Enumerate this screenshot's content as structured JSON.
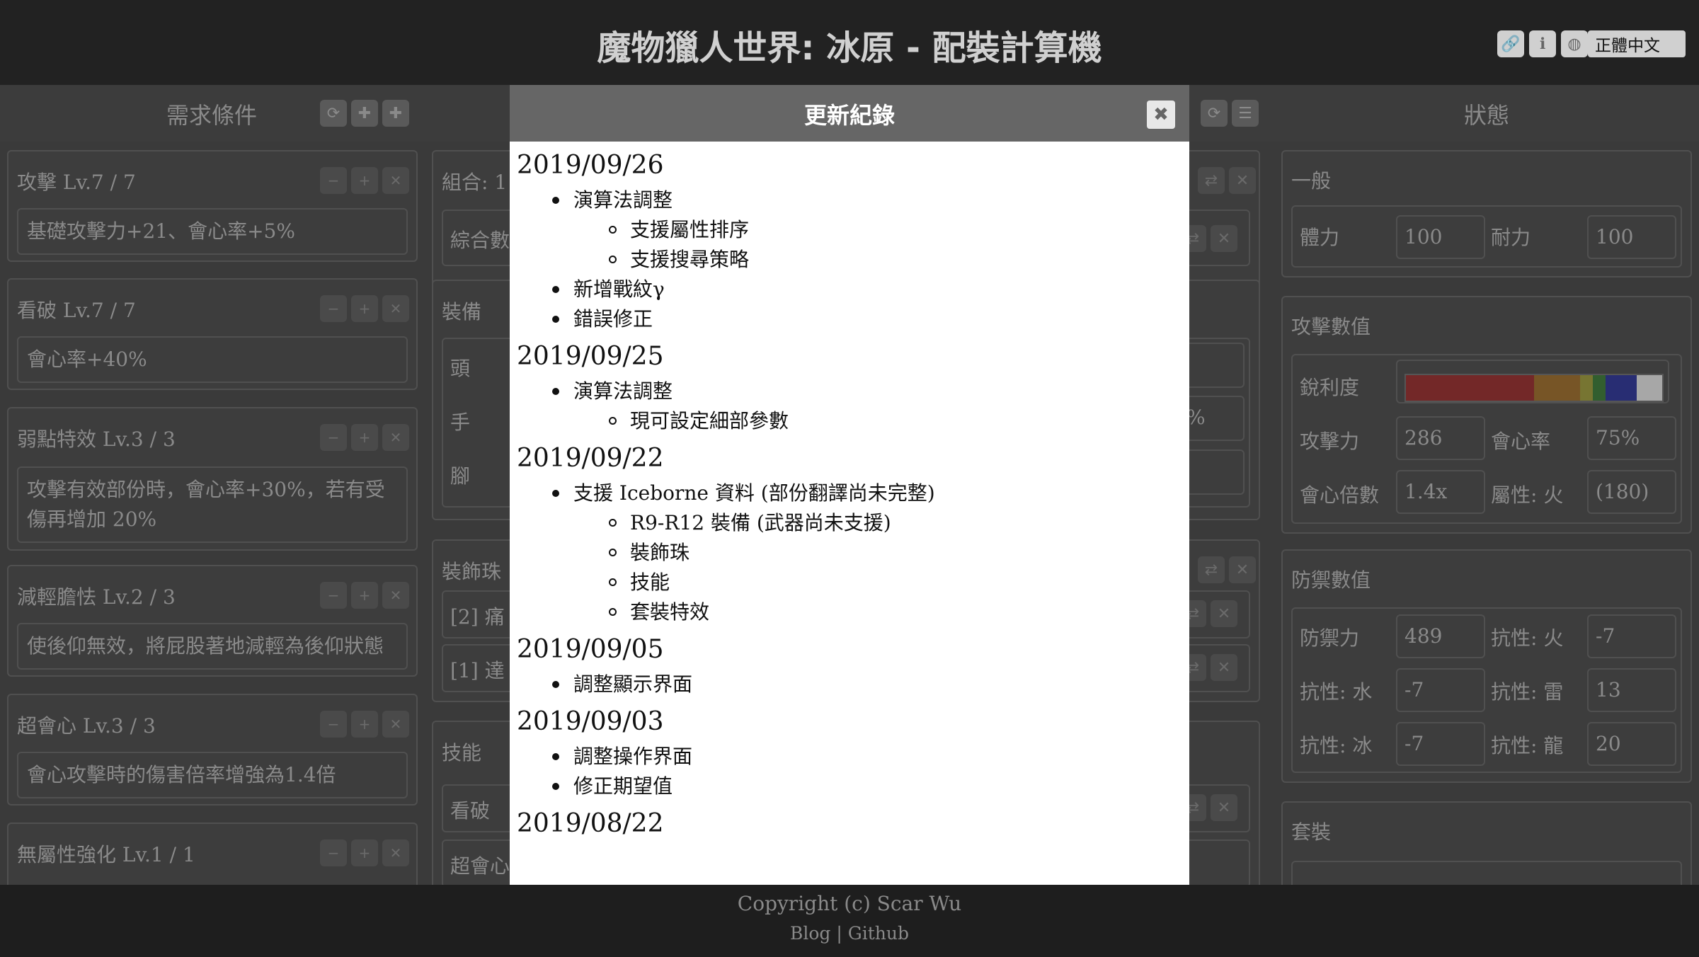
{
  "header": {
    "title": "魔物獵人世界: 冰原 - 配裝計算機",
    "language": "正體中文"
  },
  "left_panel": {
    "title": "需求條件",
    "skills": [
      {
        "name": "攻擊 Lv.7 / 7",
        "desc": "基礎攻擊力+21、會心率+5%"
      },
      {
        "name": "看破 Lv.7 / 7",
        "desc": "會心率+40%"
      },
      {
        "name": "弱點特效 Lv.3 / 3",
        "desc": "攻擊有效部份時，會心率+30%，若有受傷再增加 20%"
      },
      {
        "name": "減輕膽怯 Lv.2 / 3",
        "desc": "使後仰無效，將屁股著地減輕為後仰狀態"
      },
      {
        "name": "超會心 Lv.3 / 3",
        "desc": "會心攻擊時的傷害倍率增強為1.4倍"
      },
      {
        "name": "無屬性強化 Lv.1 / 1",
        "desc": ""
      }
    ]
  },
  "middle_panel": {
    "combo_label": "組合: 1 /",
    "summary_label": "綜合數",
    "equip_label": "裝備",
    "head": "頭",
    "hand": "手",
    "foot": "腳",
    "deco_label": "裝飾珠",
    "deco_1": "[2] 痛",
    "deco_2": "[1] 達",
    "skill_label": "技能",
    "skill_1": "看破",
    "skill_2": "超會心",
    "pct": "%"
  },
  "right_panel": {
    "title": "狀態",
    "general": {
      "title": "一般",
      "hp_label": "體力",
      "hp": "100",
      "stamina_label": "耐力",
      "stamina": "100"
    },
    "attack": {
      "title": "攻擊數值",
      "sharpness_label": "銳利度",
      "atk_label": "攻擊力",
      "atk": "286",
      "crit_label": "會心率",
      "crit": "75%",
      "crit_mult_label": "會心倍數",
      "crit_mult": "1.4x",
      "element_label": "屬性: 火",
      "element": "(180)"
    },
    "defense": {
      "title": "防禦數值",
      "def_label": "防禦力",
      "def": "489",
      "fire_label": "抗性: 火",
      "fire": "-7",
      "water_label": "抗性: 水",
      "water": "-7",
      "thunder_label": "抗性: 雷",
      "thunder": "13",
      "ice_label": "抗性: 冰",
      "ice": "-7",
      "dragon_label": "抗性: 龍",
      "dragon": "20"
    },
    "set_title": "套裝"
  },
  "modal": {
    "title": "更新紀錄",
    "entries": [
      {
        "date": "2019/09/26",
        "items": [
          {
            "text": "演算法調整",
            "sub": [
              "支援屬性排序",
              "支援搜尋策略"
            ]
          },
          {
            "text": "新增戰紋γ",
            "sub": []
          },
          {
            "text": "錯誤修正",
            "sub": []
          }
        ]
      },
      {
        "date": "2019/09/25",
        "items": [
          {
            "text": "演算法調整",
            "sub": [
              "現可設定細部參數"
            ]
          }
        ]
      },
      {
        "date": "2019/09/22",
        "items": [
          {
            "text": "支援 Iceborne 資料 (部份翻譯尚未完整)",
            "sub": [
              "R9-R12 裝備 (武器尚未支援)",
              "裝飾珠",
              "技能",
              "套裝特效"
            ]
          }
        ]
      },
      {
        "date": "2019/09/05",
        "items": [
          {
            "text": "調整顯示界面",
            "sub": []
          }
        ]
      },
      {
        "date": "2019/09/03",
        "items": [
          {
            "text": "調整操作界面",
            "sub": []
          },
          {
            "text": "修正期望值",
            "sub": []
          }
        ]
      },
      {
        "date": "2019/08/22",
        "items": []
      }
    ]
  },
  "footer": {
    "copyright": "Copyright (c) Scar Wu",
    "blog": "Blog",
    "separator": "|",
    "github": "Github"
  },
  "colors": {
    "sharpness": [
      "#a01818",
      "#a86a14",
      "#a8a42a",
      "#2a7a24",
      "#1820a0",
      "#ffffff"
    ]
  }
}
